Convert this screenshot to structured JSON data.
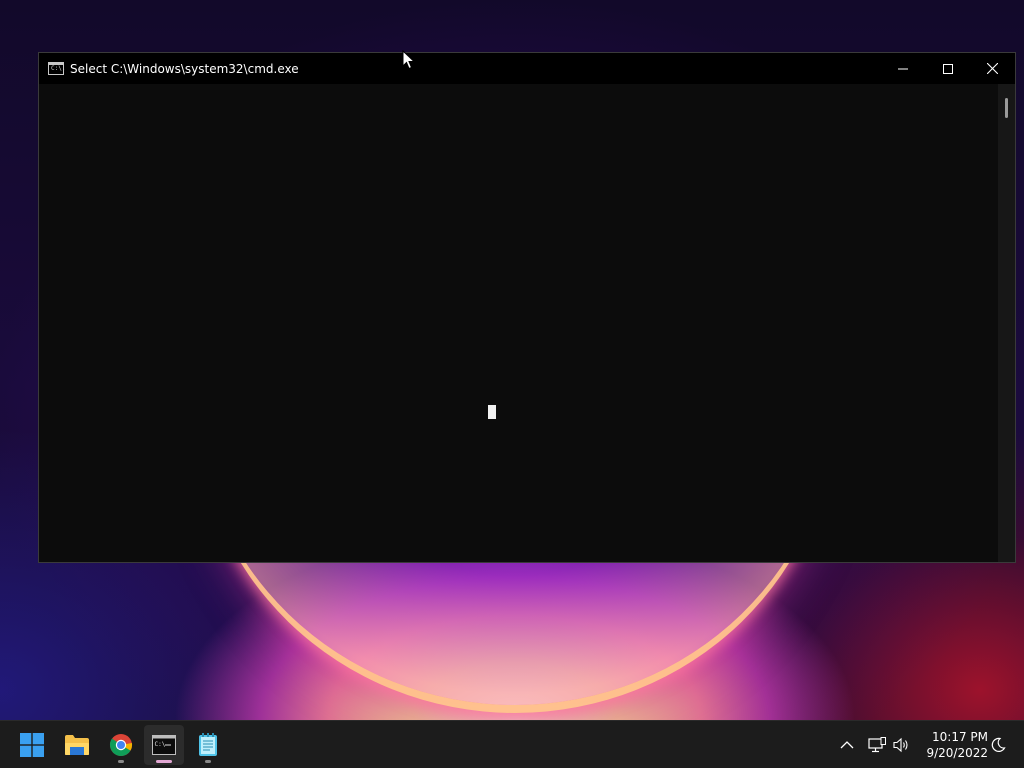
{
  "desktop": {
    "wallpaper": "windows-11-bloom-dark"
  },
  "window": {
    "title": "Select C:\\Windows\\system32\\cmd.exe",
    "icon": "cmd-icon",
    "icon_text": "C:\\.",
    "controls": {
      "minimize": "minimize-icon",
      "maximize": "maximize-icon",
      "close": "close-icon"
    },
    "console_background": "#0c0c0c",
    "cursor_color": "#f2f2f2"
  },
  "taskbar": {
    "apps": [
      {
        "name": "Start",
        "icon": "windows-start-icon",
        "running": false
      },
      {
        "name": "File Explorer",
        "icon": "folder-icon",
        "running": false
      },
      {
        "name": "Google Chrome",
        "icon": "chrome-icon",
        "running": true
      },
      {
        "name": "Command Prompt",
        "icon": "terminal-icon",
        "running": true,
        "active": true
      },
      {
        "name": "Notepad",
        "icon": "notepad-icon",
        "running": true
      }
    ],
    "tray": {
      "overflow_icon": "chevron-up-icon",
      "network_icon": "network-icon",
      "volume_icon": "volume-icon",
      "focus_icon": "moon-icon"
    },
    "clock": {
      "time": "10:17 PM",
      "date": "9/20/2022"
    }
  },
  "colors": {
    "taskbar_bg": "#1c1c1c",
    "titlebar_bg": "#000000",
    "active_indicator": "#e3a8d4"
  }
}
